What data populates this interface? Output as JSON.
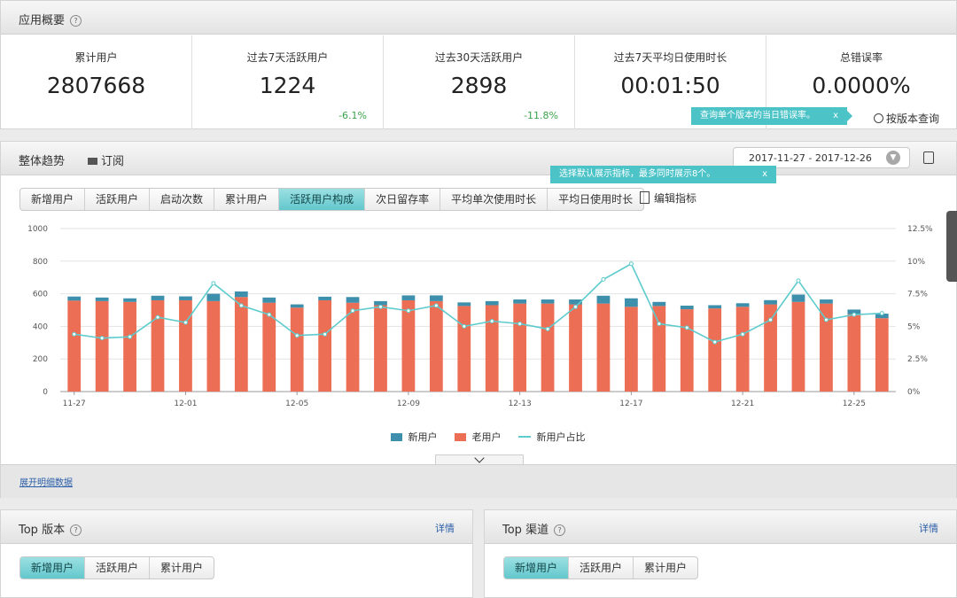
{
  "overview": {
    "title": "应用概要",
    "stats": [
      {
        "label": "累计用户",
        "value": "2807668",
        "change": ""
      },
      {
        "label": "过去7天活跃用户",
        "value": "1224",
        "change": "-6.1%"
      },
      {
        "label": "过去30天活跃用户",
        "value": "2898",
        "change": "-11.8%"
      },
      {
        "label": "过去7天平均日使用时长",
        "value": "00:01:50",
        "change": ""
      },
      {
        "label": "总错误率",
        "value": "0.0000%",
        "change": ""
      }
    ],
    "tooltip": "查询单个版本的当日错误率。",
    "tooltip_close": "x",
    "version_query": "按版本查询"
  },
  "trend": {
    "title": "整体趋势",
    "subscribe": "订阅",
    "date_range": "2017-11-27 - 2017-12-26",
    "tooltip": "选择默认展示指标，最多同时展示8个。",
    "tooltip_close": "x",
    "tabs": [
      "新增用户",
      "活跃用户",
      "启动次数",
      "累计用户",
      "活跃用户构成",
      "次日留存率",
      "平均单次使用时长",
      "平均日使用时长"
    ],
    "active_tab": 4,
    "edit_metrics": "编辑指标",
    "expand_detail": "展开明细数据"
  },
  "chart_data": {
    "type": "bar",
    "x": [
      "11-27",
      "11-28",
      "11-29",
      "11-30",
      "12-01",
      "12-02",
      "12-03",
      "12-04",
      "12-05",
      "12-06",
      "12-07",
      "12-08",
      "12-09",
      "12-10",
      "12-11",
      "12-12",
      "12-13",
      "12-14",
      "12-15",
      "12-16",
      "12-17",
      "12-18",
      "12-19",
      "12-20",
      "12-21",
      "12-22",
      "12-23",
      "12-24",
      "12-25",
      "12-26"
    ],
    "x_tick_labels": [
      "11-27",
      "12-01",
      "12-05",
      "12-09",
      "12-13",
      "12-17",
      "12-21",
      "12-25"
    ],
    "series": [
      {
        "name": "新用户",
        "color": "#3d8fab",
        "values": [
          25,
          22,
          22,
          28,
          24,
          45,
          34,
          32,
          20,
          22,
          35,
          25,
          30,
          35,
          22,
          25,
          25,
          25,
          30,
          48,
          52,
          25,
          22,
          20,
          22,
          26,
          45,
          25,
          28,
          28
        ]
      },
      {
        "name": "老用户",
        "color": "#ec6e54",
        "values": [
          558,
          555,
          550,
          560,
          560,
          555,
          580,
          545,
          515,
          560,
          545,
          530,
          560,
          555,
          525,
          530,
          540,
          540,
          535,
          540,
          520,
          525,
          505,
          510,
          520,
          535,
          550,
          540,
          475,
          450
        ]
      },
      {
        "name": "新用户占比",
        "color": "#5ecbcd",
        "axis": "right",
        "values": [
          4.4,
          4.1,
          4.2,
          5.7,
          5.3,
          8.3,
          6.6,
          5.9,
          4.3,
          4.4,
          6.2,
          6.5,
          6.2,
          6.6,
          5.0,
          5.4,
          5.2,
          4.8,
          6.5,
          8.6,
          9.8,
          5.2,
          4.9,
          3.8,
          4.4,
          5.5,
          8.5,
          5.5,
          5.9,
          6.0
        ]
      }
    ],
    "ylim": [
      0,
      1000
    ],
    "y_ticks": [
      0,
      200,
      400,
      600,
      800,
      1000
    ],
    "y2lim": [
      0,
      12.5
    ],
    "y2_ticks": [
      "0%",
      "2.5%",
      "5%",
      "7.5%",
      "10%",
      "12.5%"
    ],
    "grid": true,
    "legend": "bottom"
  },
  "top_version": {
    "title": "Top 版本",
    "detail": "详情",
    "tabs": [
      "新增用户",
      "活跃用户",
      "累计用户"
    ]
  },
  "top_channel": {
    "title": "Top 渠道",
    "detail": "详情",
    "tabs": [
      "新增用户",
      "活跃用户",
      "累计用户"
    ]
  }
}
